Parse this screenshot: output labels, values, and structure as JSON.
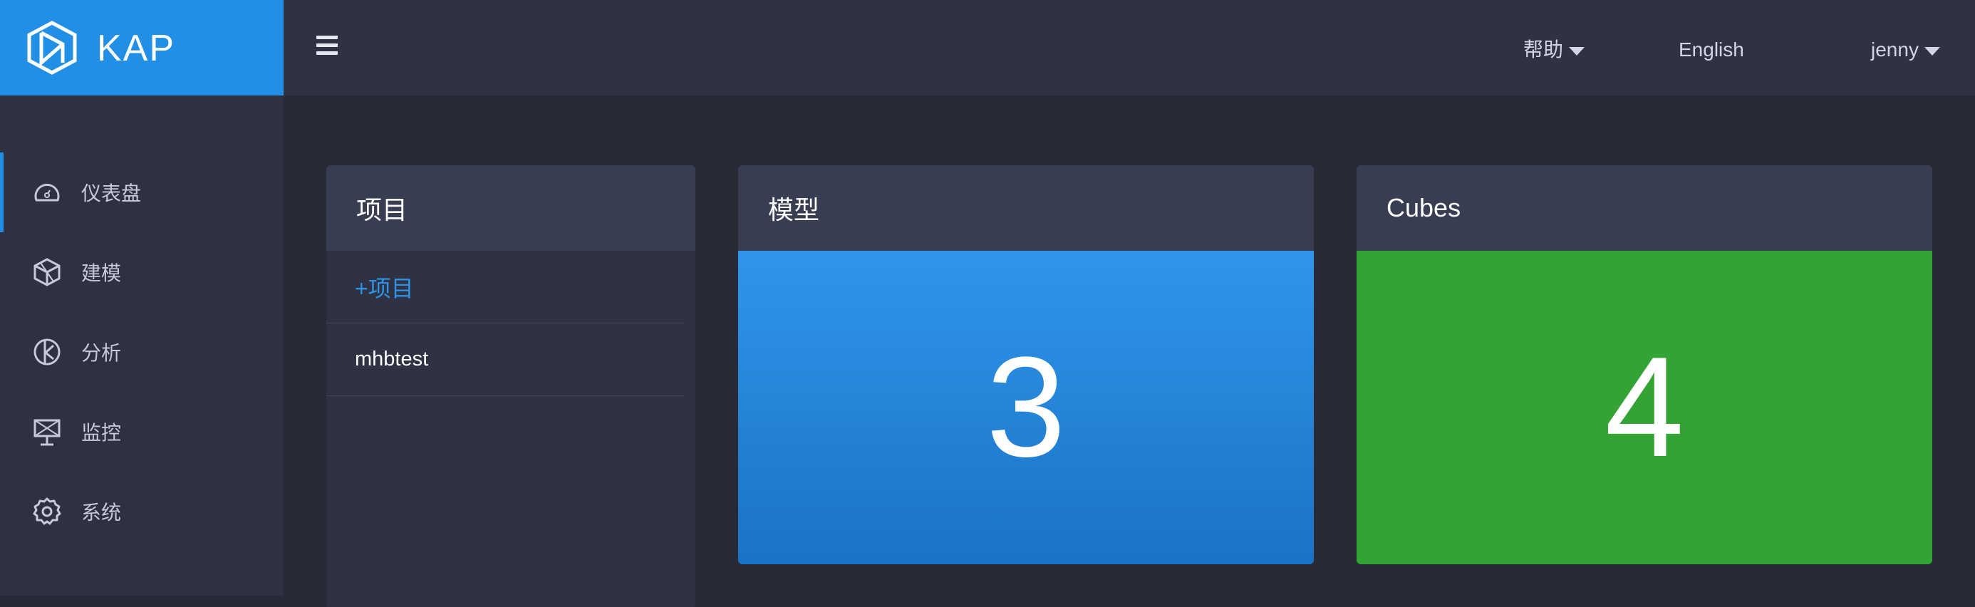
{
  "brand": {
    "name": "KAP",
    "logo_icon": "kap-hexagon-logo-icon",
    "color": "#218fe6"
  },
  "sidebar": {
    "items": [
      {
        "label": "仪表盘",
        "icon": "dashboard-gauge-icon",
        "active": true
      },
      {
        "label": "建模",
        "icon": "cube-model-icon",
        "active": false
      },
      {
        "label": "分析",
        "icon": "analysis-pie-icon",
        "active": false
      },
      {
        "label": "监控",
        "icon": "monitor-board-icon",
        "active": false
      },
      {
        "label": "系统",
        "icon": "gear-icon",
        "active": false
      }
    ]
  },
  "header": {
    "menu_icon": "hamburger-menu-icon",
    "help": "帮助",
    "language": "English",
    "user": "jenny"
  },
  "projects_card": {
    "title": "项目",
    "add_label": "+项目",
    "items": [
      "mhbtest"
    ]
  },
  "models_card": {
    "title": "模型",
    "count": "3",
    "color": "#218fe6"
  },
  "cubes_card": {
    "title": "Cubes",
    "count": "4",
    "color": "#33a334"
  }
}
